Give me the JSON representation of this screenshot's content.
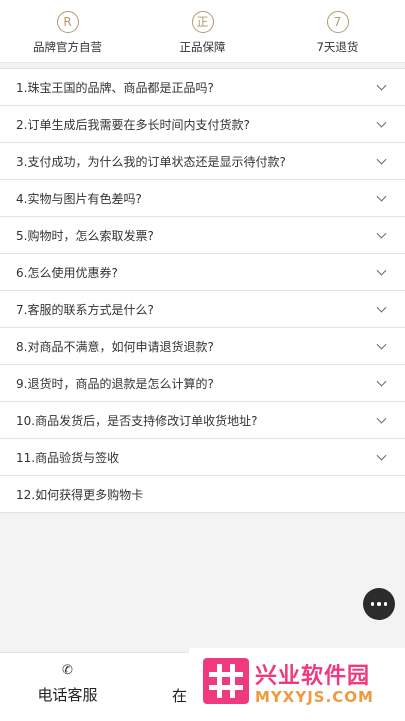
{
  "badges": [
    {
      "icon_text": "R",
      "label": "品牌官方自营"
    },
    {
      "icon_text": "正",
      "label": "正品保障"
    },
    {
      "icon_text": "7",
      "label": "7天退货"
    }
  ],
  "faq": [
    "1.珠宝王国的品牌、商品都是正品吗?",
    "2.订单生成后我需要在多长时间内支付货款?",
    "3.支付成功，为什么我的订单状态还是显示待付款?",
    "4.实物与图片有色差吗?",
    "5.购物时，怎么索取发票?",
    "6.怎么使用优惠券?",
    "7.客服的联系方式是什么?",
    "8.对商品不满意，如何申请退货退款?",
    "9.退货时，商品的退款是怎么计算的?",
    "10.商品发货后，是否支持修改订单收货地址?",
    "11.商品验货与签收",
    "12.如何获得更多购物卡"
  ],
  "bottom": {
    "phone_label": "电话客服",
    "online_label": "在"
  },
  "watermark": {
    "title": "兴业软件园",
    "url": "MYXYJS.COM"
  },
  "colors": {
    "badge_gold": "#b49a6a",
    "watermark_pink": "#ef3a7f",
    "watermark_orange": "#f09a3c"
  }
}
